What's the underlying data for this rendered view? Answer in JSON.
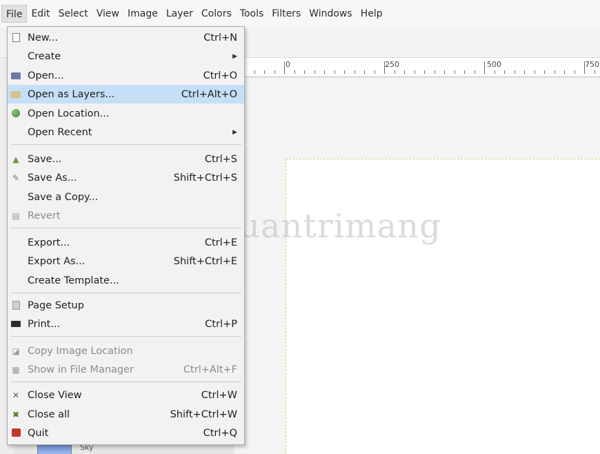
{
  "menubar": {
    "items": [
      {
        "label": "File",
        "active": true
      },
      {
        "label": "Edit"
      },
      {
        "label": "Select"
      },
      {
        "label": "View"
      },
      {
        "label": "Image"
      },
      {
        "label": "Layer"
      },
      {
        "label": "Colors"
      },
      {
        "label": "Tools"
      },
      {
        "label": "Filters"
      },
      {
        "label": "Windows"
      },
      {
        "label": "Help"
      }
    ]
  },
  "ruler": {
    "labels": [
      "0",
      "250",
      "500",
      "750"
    ]
  },
  "file_menu": {
    "new": {
      "label": "New...",
      "accel": "Ctrl+N"
    },
    "create": {
      "label": "Create"
    },
    "open": {
      "label": "Open...",
      "accel": "Ctrl+O"
    },
    "open_as_layers": {
      "label": "Open as Layers...",
      "accel": "Ctrl+Alt+O"
    },
    "open_location": {
      "label": "Open Location..."
    },
    "open_recent": {
      "label": "Open Recent"
    },
    "save": {
      "label": "Save...",
      "accel": "Ctrl+S"
    },
    "save_as": {
      "label": "Save As...",
      "accel": "Shift+Ctrl+S"
    },
    "save_copy": {
      "label": "Save a Copy..."
    },
    "revert": {
      "label": "Revert"
    },
    "export": {
      "label": "Export...",
      "accel": "Ctrl+E"
    },
    "export_as": {
      "label": "Export As...",
      "accel": "Shift+Ctrl+E"
    },
    "create_template": {
      "label": "Create Template..."
    },
    "page_setup": {
      "label": "Page Setup"
    },
    "print": {
      "label": "Print...",
      "accel": "Ctrl+P"
    },
    "copy_image_location": {
      "label": "Copy Image Location"
    },
    "show_in_file_manager": {
      "label": "Show in File Manager",
      "accel": "Ctrl+Alt+F"
    },
    "close_view": {
      "label": "Close View",
      "accel": "Ctrl+W"
    },
    "close_all": {
      "label": "Close all",
      "accel": "Shift+Ctrl+W"
    },
    "quit": {
      "label": "Quit",
      "accel": "Ctrl+Q"
    }
  },
  "layers": {
    "visible_layer": "Sky"
  },
  "watermark": "uantrimang",
  "colors": {
    "highlight": "#c5dff7",
    "menu_bg": "#f2f2f2",
    "page_border": "#cfcf7a"
  }
}
